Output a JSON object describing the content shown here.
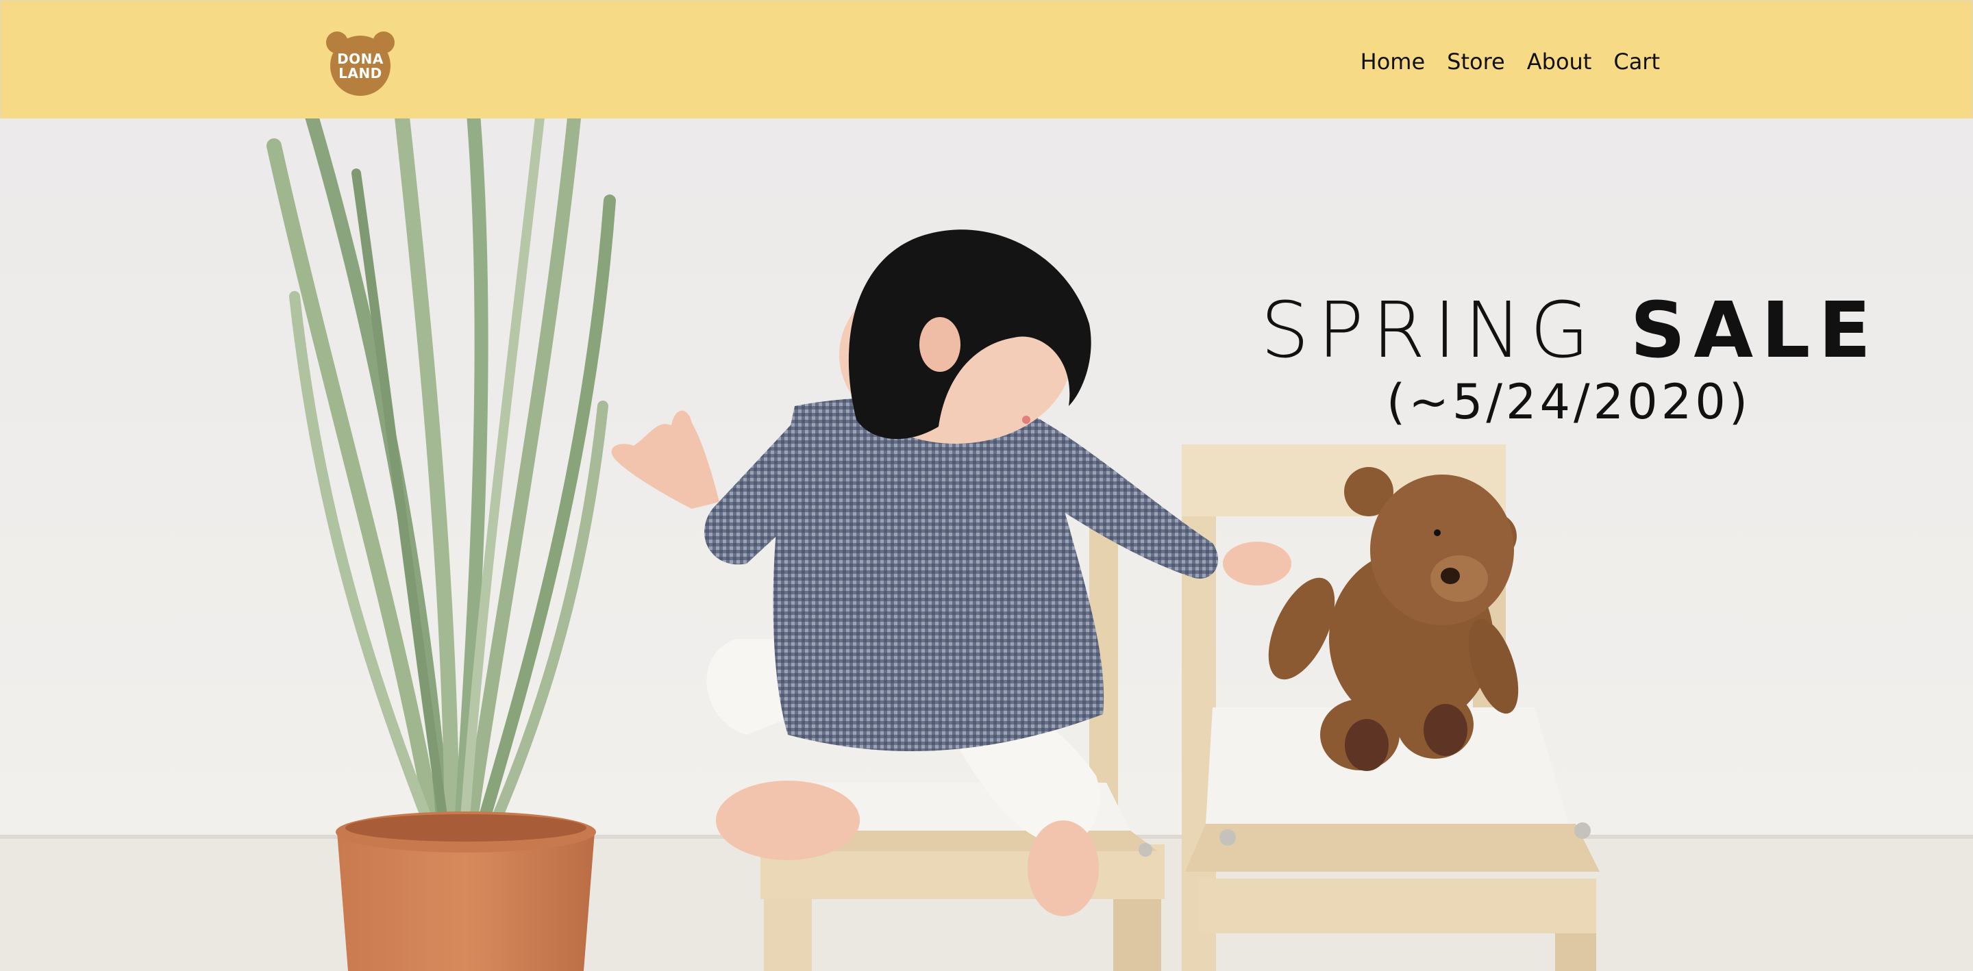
{
  "brand": {
    "line1": "DONA",
    "line2": "LAND",
    "color": "#b77f3d"
  },
  "header": {
    "background": "#f6da86"
  },
  "nav": {
    "items": [
      "Home",
      "Store",
      "About",
      "Cart"
    ]
  },
  "hero": {
    "headline_light": "SPRING",
    "headline_bold": "SALE",
    "date_text": "(~5/24/2020)",
    "image": "baby-with-teddy-bear-photo"
  }
}
